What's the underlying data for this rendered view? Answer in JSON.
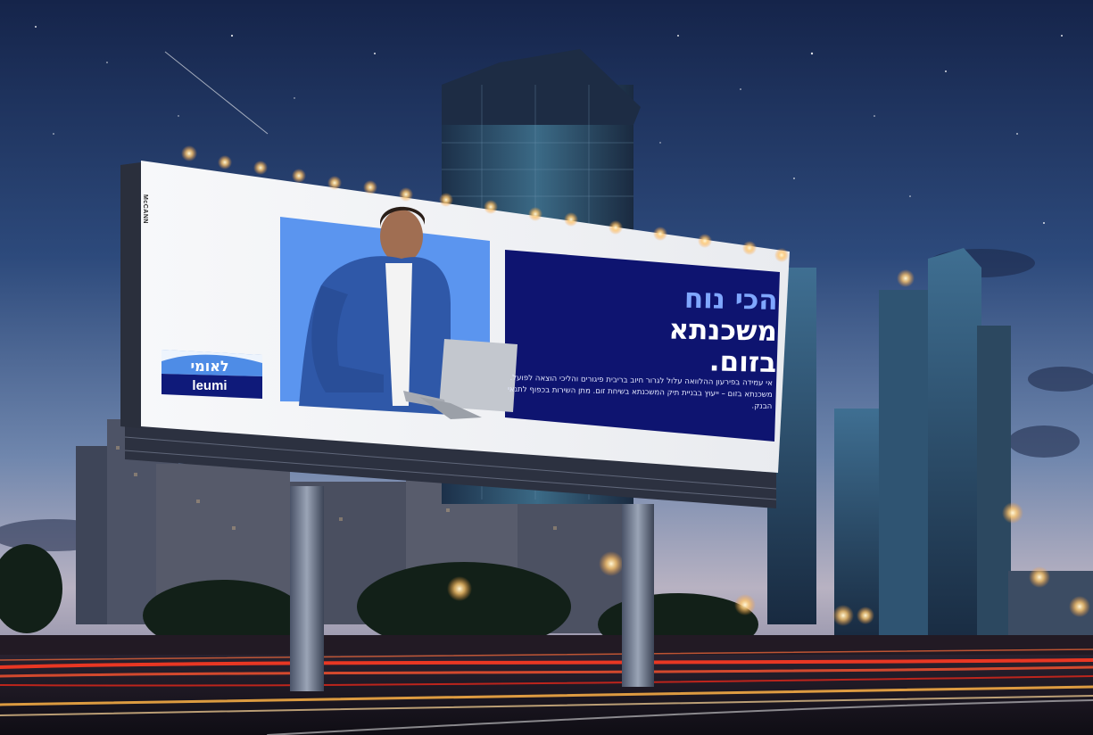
{
  "billboard": {
    "headline": [
      "הכי נוח",
      "משכנתא",
      "בזום."
    ],
    "body": "אי עמידה בפירעון ההלוואה עלול לגרור חיוב בריבית פיגורים והליכי הוצאה לפועל. משכנתא בזום – ייעוץ בבניית תיק המשכנתא בשיחת זום. מתן השירות בכפוף לתנאי הבנק.",
    "brand_he": "לאומי",
    "brand_en": "leumi",
    "agency": "McCANN"
  },
  "colors": {
    "sky_top": "#1b2c55",
    "sky_mid": "#3c5a8c",
    "horizon": "#c7b9c0",
    "panel_navy": "#0e1470",
    "photo_blue": "#5b95ef",
    "headline_accent": "#7fa7ff",
    "brand_blue": "#0f1a7a",
    "brand_light": "#4e8ce6",
    "light_trail_red": "#ff3a22",
    "light_trail_orange": "#ffb347"
  }
}
